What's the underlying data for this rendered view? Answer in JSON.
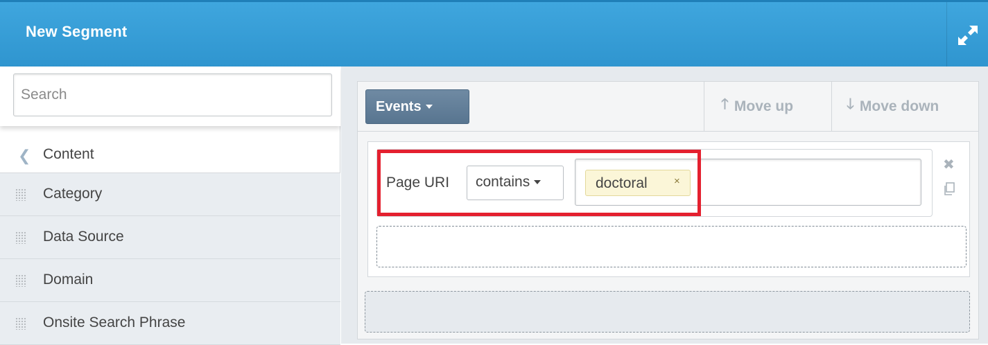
{
  "header": {
    "title": "New Segment",
    "expand_icon": "expand-icon"
  },
  "sidebar": {
    "search_placeholder": "Search",
    "back_label": "Content",
    "items": [
      {
        "label": "Category"
      },
      {
        "label": "Data Source"
      },
      {
        "label": "Domain"
      },
      {
        "label": "Onsite Search Phrase"
      }
    ]
  },
  "toolbar": {
    "events_label": "Events",
    "move_up_label": "Move up",
    "move_down_label": "Move down"
  },
  "condition": {
    "field_label": "Page URI",
    "operator": "contains",
    "tags": [
      {
        "label": "doctoral",
        "remove": "×"
      }
    ],
    "remove_icon": "✖"
  },
  "colors": {
    "header": "#3a9fd9",
    "events_button": "#5f7d98",
    "highlight": "#e4202f",
    "tag_bg": "#fbf6d8"
  }
}
